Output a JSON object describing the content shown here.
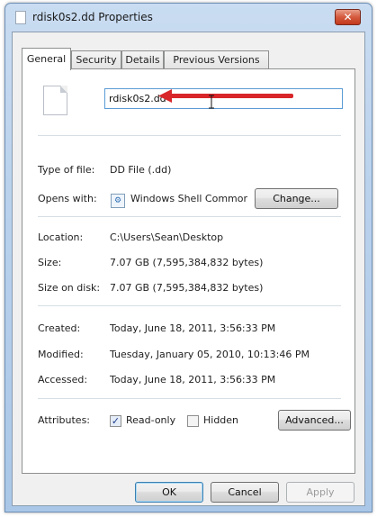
{
  "window": {
    "title": "rdisk0s2.dd Properties",
    "close_glyph": "✕"
  },
  "tabs": [
    {
      "label": "General"
    },
    {
      "label": "Security"
    },
    {
      "label": "Details"
    },
    {
      "label": "Previous Versions"
    }
  ],
  "general": {
    "file_name": "rdisk0s2.dd",
    "type_label": "Type of file:",
    "type_value": "DD File (.dd)",
    "opens_label": "Opens with:",
    "opens_value": "Windows Shell Commor",
    "change_label": "Change...",
    "location_label": "Location:",
    "location_value": "C:\\Users\\Sean\\Desktop",
    "size_label": "Size:",
    "size_value": "7.07 GB (7,595,384,832 bytes)",
    "size_on_disk_label": "Size on disk:",
    "size_on_disk_value": "7.07 GB (7,595,384,832 bytes)",
    "created_label": "Created:",
    "created_value": "Today, June 18, 2011, 3:56:33 PM",
    "modified_label": "Modified:",
    "modified_value": "Tuesday, January 05, 2010, 10:13:46 PM",
    "accessed_label": "Accessed:",
    "accessed_value": "Today, June 18, 2011, 3:56:33 PM",
    "attributes_label": "Attributes:",
    "readonly_label": "Read-only",
    "readonly_checked": true,
    "hidden_label": "Hidden",
    "hidden_checked": false,
    "advanced_label": "Advanced..."
  },
  "footer": {
    "ok_label": "OK",
    "cancel_label": "Cancel",
    "apply_label": "Apply"
  },
  "icons": {
    "title": "file-icon",
    "file": "blank-document-icon",
    "opens_with": "shell-app-icon",
    "annotation": "red-arrow-icon",
    "cursor": "text-cursor-icon"
  },
  "colors": {
    "annotation_arrow": "#d8262b",
    "accent": "#5b9bd5"
  }
}
